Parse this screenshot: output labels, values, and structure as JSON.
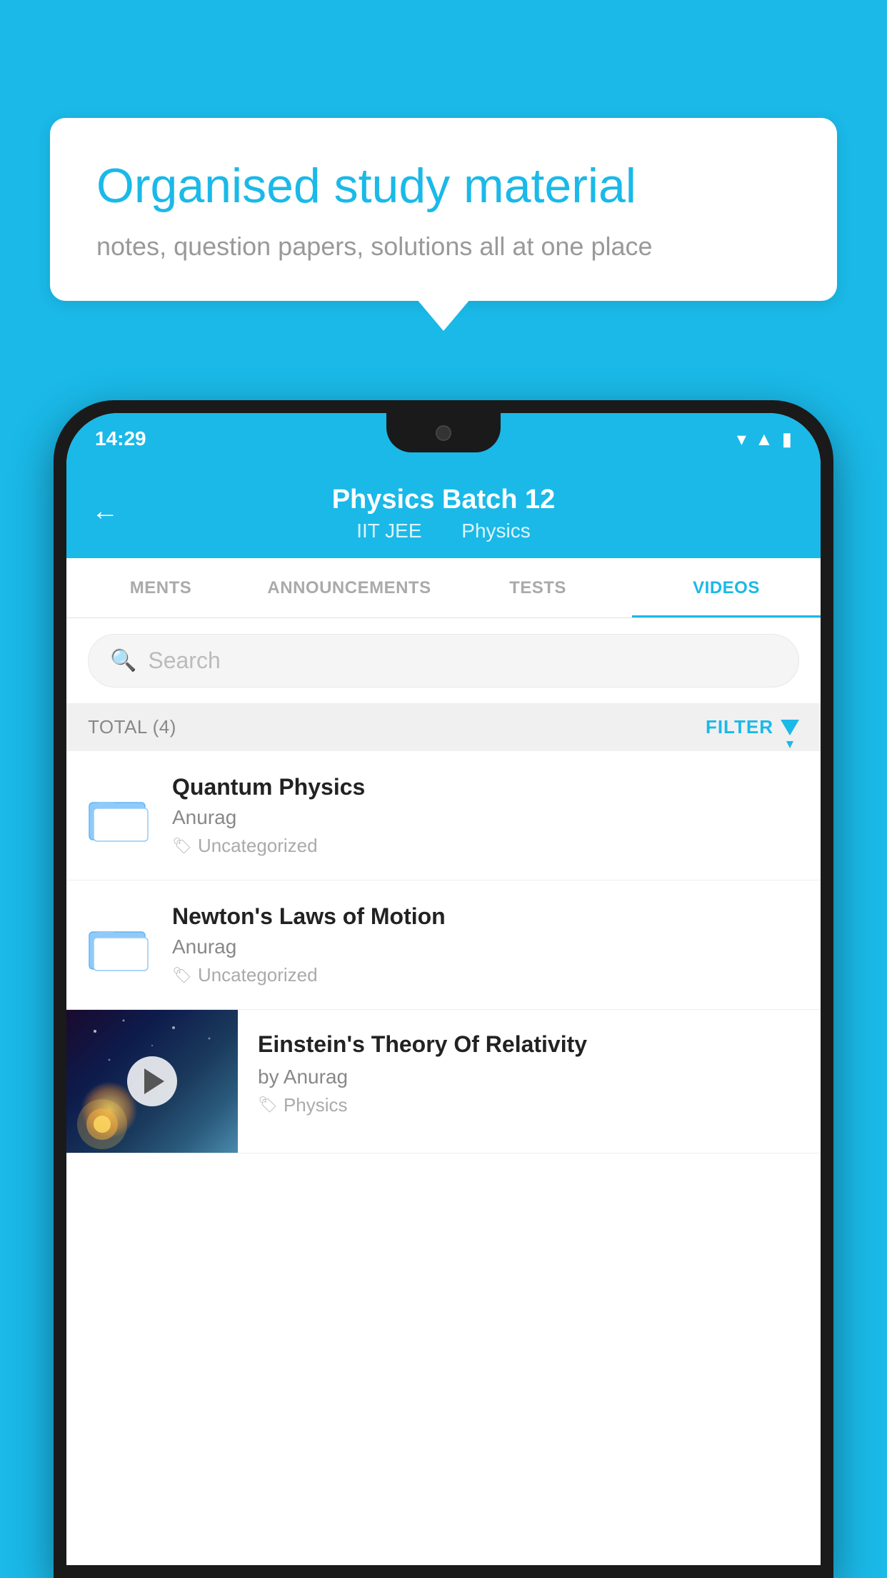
{
  "bubble": {
    "title": "Organised study material",
    "subtitle": "notes, question papers, solutions all at one place"
  },
  "status_bar": {
    "time": "14:29"
  },
  "header": {
    "title": "Physics Batch 12",
    "subtitle1": "IIT JEE",
    "subtitle2": "Physics",
    "back_label": "←"
  },
  "tabs": [
    {
      "label": "MENTS",
      "active": false
    },
    {
      "label": "ANNOUNCEMENTS",
      "active": false
    },
    {
      "label": "TESTS",
      "active": false
    },
    {
      "label": "VIDEOS",
      "active": true
    }
  ],
  "search": {
    "placeholder": "Search"
  },
  "filter_bar": {
    "total_label": "TOTAL (4)",
    "filter_label": "FILTER"
  },
  "videos": [
    {
      "id": 1,
      "title": "Quantum Physics",
      "author": "Anurag",
      "tag": "Uncategorized",
      "has_thumbnail": false
    },
    {
      "id": 2,
      "title": "Newton's Laws of Motion",
      "author": "Anurag",
      "tag": "Uncategorized",
      "has_thumbnail": false
    },
    {
      "id": 3,
      "title": "Einstein's Theory Of Relativity",
      "author": "by Anurag",
      "tag": "Physics",
      "has_thumbnail": true
    }
  ]
}
